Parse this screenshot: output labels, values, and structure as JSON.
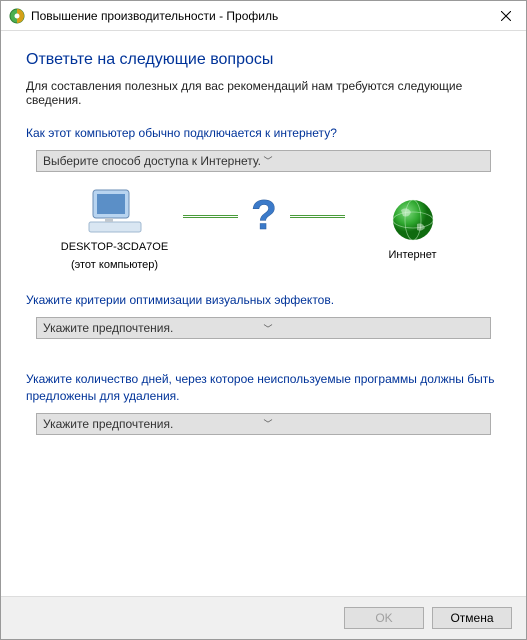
{
  "titlebar": {
    "title": "Повышение производительности - Профиль"
  },
  "heading": "Ответьте на следующие вопросы",
  "subtext": "Для составления полезных для вас рекомендаций нам требуются следующие сведения.",
  "q1": {
    "label": "Как этот компьютер обычно подключается к интернету?",
    "dropdown": "Выберите способ доступа к Интернету."
  },
  "diagram": {
    "computer_name": "DESKTOP-3CDA7OE",
    "computer_sub": "(этот компьютер)",
    "internet": "Интернет"
  },
  "q2": {
    "label": "Укажите критерии оптимизации визуальных эффектов.",
    "dropdown": "Укажите предпочтения."
  },
  "q3": {
    "label": "Укажите количество дней, через которое неиспользуемые программы должны быть предложены для удаления.",
    "dropdown": "Укажите предпочтения."
  },
  "footer": {
    "ok": "OK",
    "cancel": "Отмена"
  }
}
